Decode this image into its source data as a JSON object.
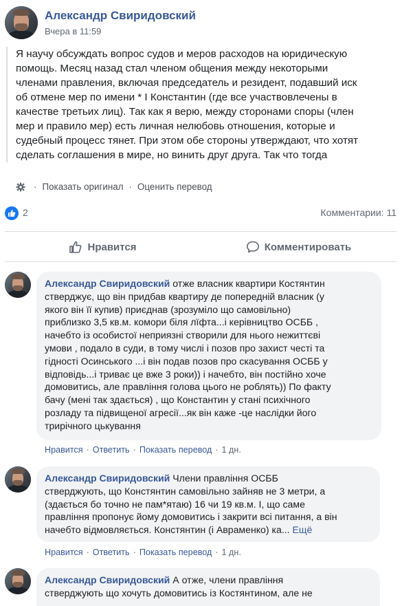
{
  "post": {
    "author": "Александр Свиридовский",
    "time": "Вчера в 11:59",
    "text_lines": [
      "Я научу обсуждать вопрос судов и меров расходов на юридическую",
      "помощь. Месяц назад стал членом общения между некоторыми",
      "членами правления, включая председатель и резидент, подавший иск",
      "об отмене мер по имени * І Константин (где все участвовлечены в",
      "качестве третьих лиц). Так как я верю, между сторонами споры (член",
      "мер и правило мер) есть личная нелюбовь отношения, которые и",
      "судебный процесс тянет. При этом обе стороны утверждают, что хотят",
      "сделать соглашения в мире, но винить друг друга. Так что тогда"
    ],
    "show_original": "Показать оригинал",
    "rate_translation": "Оценить перевод",
    "likes_count": "2",
    "comments_count": "Комментарии: 11",
    "like_action": "Нравится",
    "comment_action": "Комментировать"
  },
  "comments": [
    {
      "author": "Александр Свиридовский",
      "first_line_text": " отже власник квартири Костянтин",
      "lines": [
        "стверджує, що він придбав квартиру де попередній власник (у",
        "якого він її купив) приєднав (зрозуміло що самовільно)",
        "приблизко 3,5 кв.м. комори біля лїфта...і керівництво ОСББ ,",
        "начебто із особистої неприязні створили для нього нежиттєві",
        "умови , подало в суди, в тому числі і позов про захист честі та",
        "гідності Осинського ...і він подав позов про скасування ОСББ у",
        "відповідь...і триває це вже 3 роки)) і начебто, він постійно хоче",
        "домовитись, але правління голова цього не роблять)) По факту",
        "бачу (мені так здається) , що Константин у стані психічного",
        "розладу та підвищеної агресії...як він каже -це наслідки його",
        "трирічного цькування"
      ],
      "more": "",
      "like": "Нравится",
      "reply": "Ответить",
      "translate": "Показать перевод",
      "age": "1 дн."
    },
    {
      "author": "Александр Свиридовский",
      "first_line_text": " Члени правління ОСББ",
      "lines": [
        "стверджують, що Констянтин самовільно зайняв не 3 метри, а",
        "(здається бо точно не пам*ятаю) 16 чи 19 кв.м. І, що саме",
        "правління пропонує йому домовитись і закрити всі питання, а він",
        "начебто відмовляється. Констянтин (і Авраменко) ка..."
      ],
      "more": "Ещё",
      "like": "Нравится",
      "reply": "Ответить",
      "translate": "Показать перевод",
      "age": "1 дн."
    },
    {
      "author": "Александр Свиридовский",
      "first_line_text": " А отже, члени правління",
      "lines": [
        "стверджують що хочуть домовитись із Костянтином, але не"
      ],
      "more": "",
      "like": "",
      "reply": "",
      "translate": "",
      "age": ""
    }
  ],
  "colors": {
    "link": "#385898",
    "like_blue": "#1877f2",
    "bubble": "#f2f3f5",
    "meta": "#606770"
  }
}
